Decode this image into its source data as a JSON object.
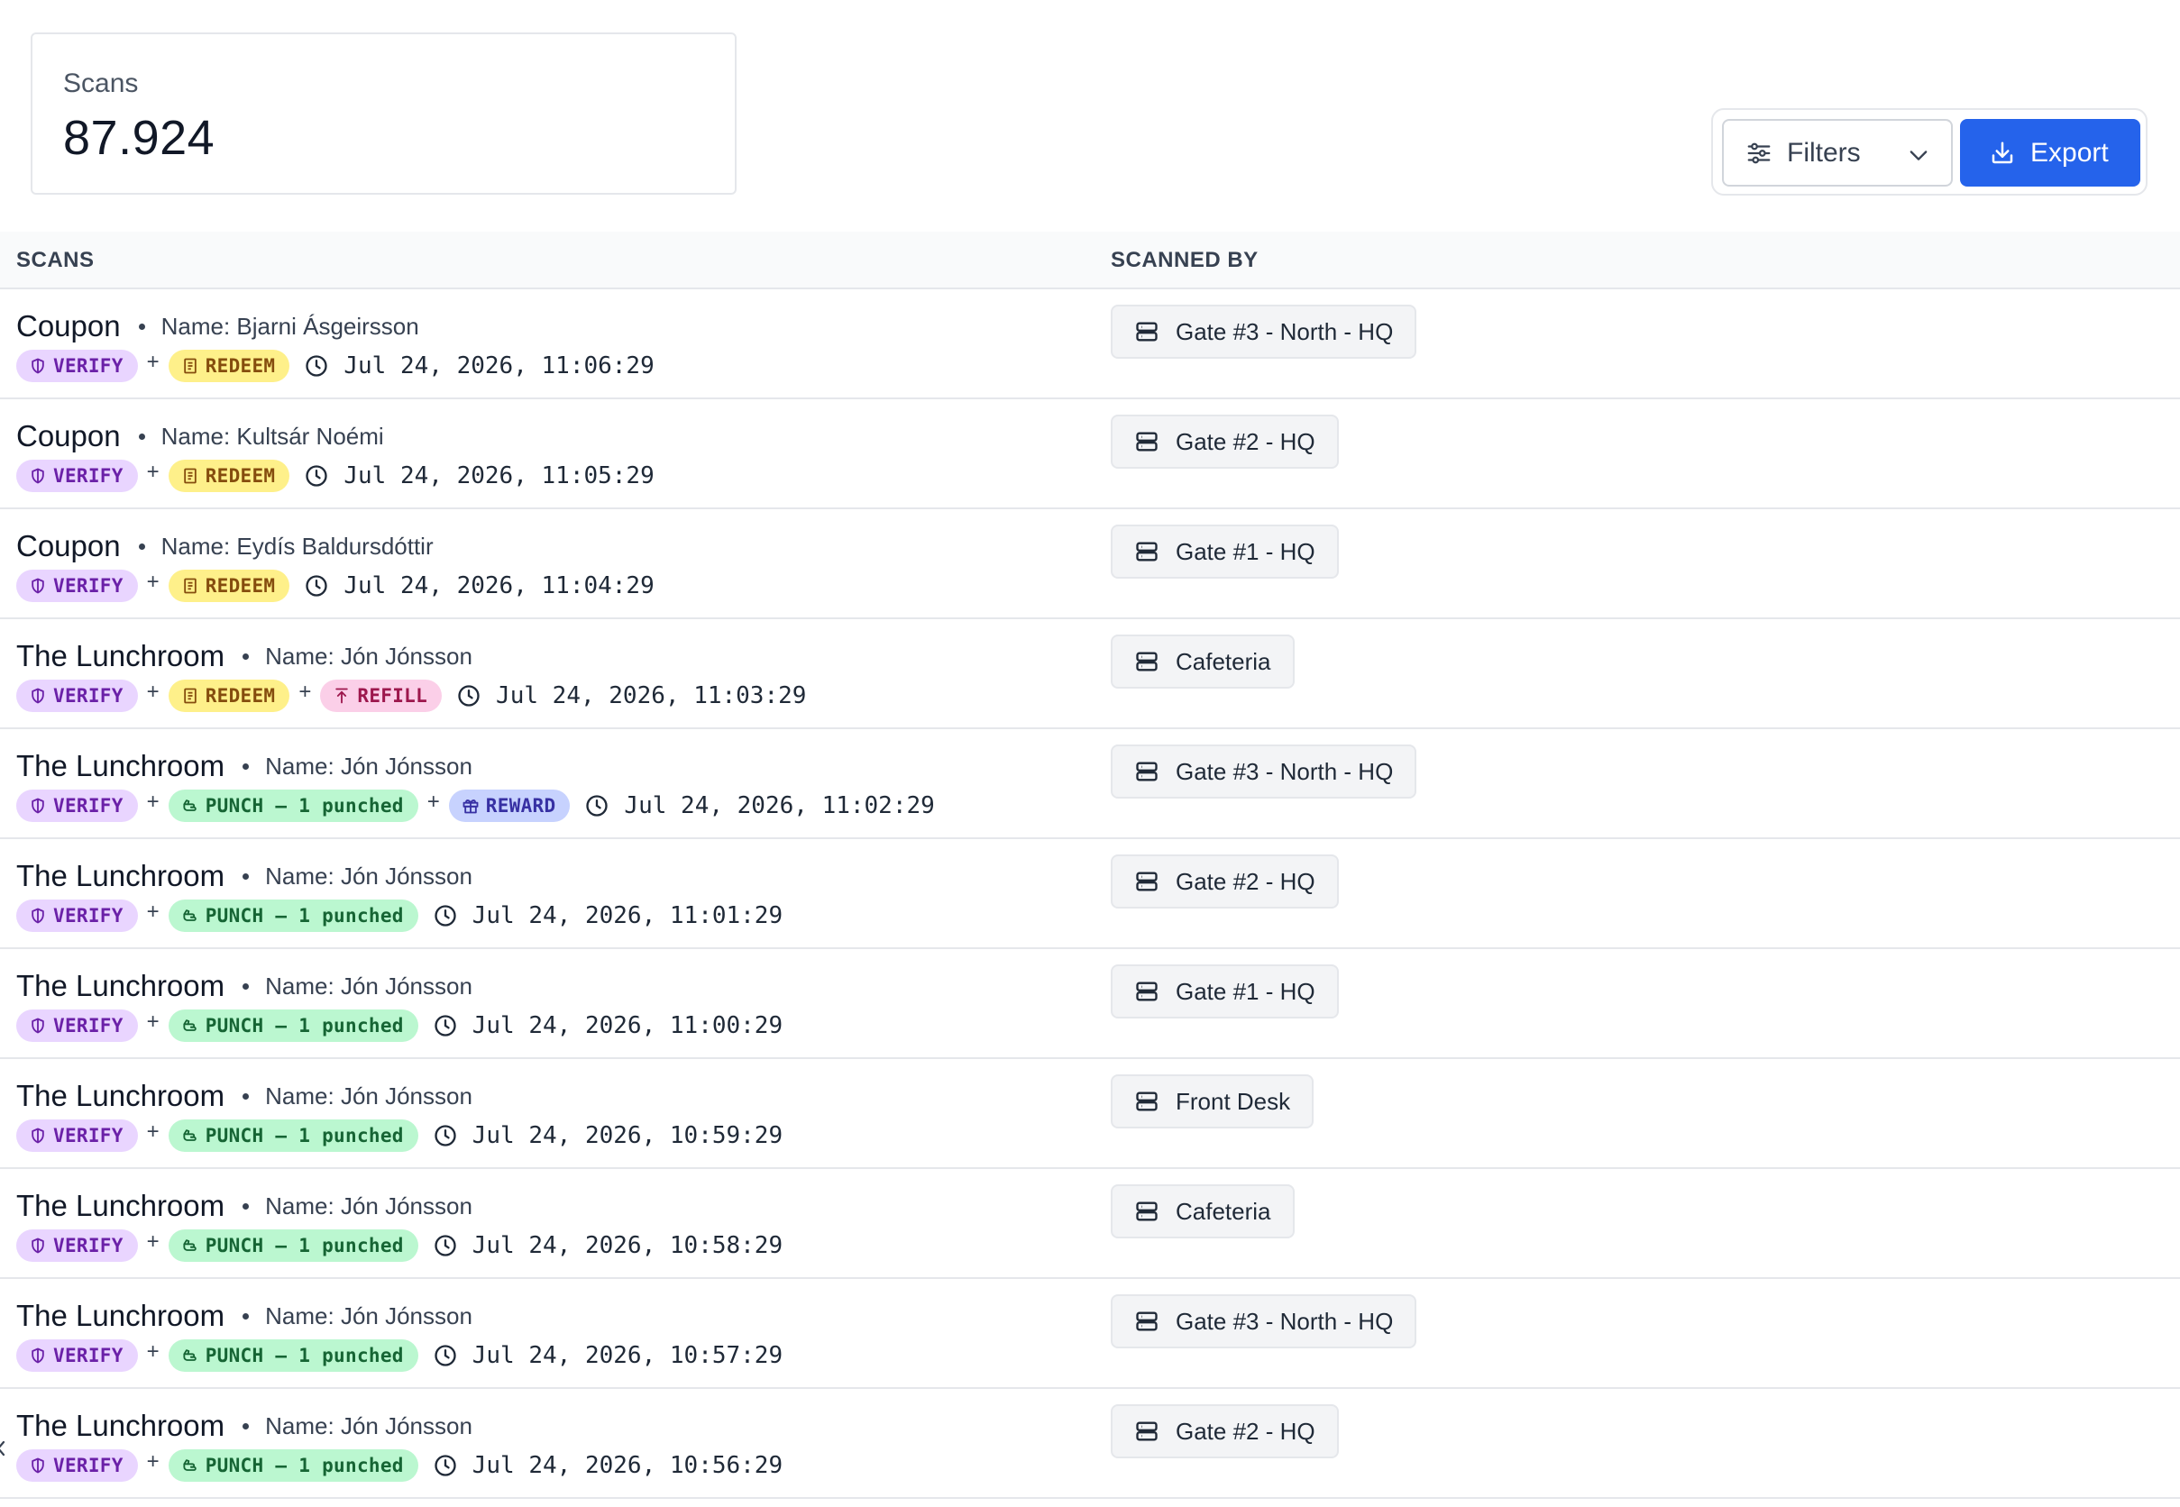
{
  "stat": {
    "label": "Scans",
    "value": "87.924"
  },
  "toolbar": {
    "filters_label": "Filters",
    "export_label": "Export"
  },
  "table": {
    "headers": {
      "scans": "SCANS",
      "scanned_by": "SCANNED BY"
    },
    "rows": [
      {
        "program": "Coupon",
        "person": "Name: Bjarni Ásgeirsson",
        "badges": [
          {
            "type": "verify",
            "label": "VERIFY"
          },
          {
            "type": "redeem",
            "label": "REDEEM"
          }
        ],
        "time": "Jul 24, 2026, 11:06:29",
        "scanner": "Gate #3 - North - HQ"
      },
      {
        "program": "Coupon",
        "person": "Name: Kultsár Noémi",
        "badges": [
          {
            "type": "verify",
            "label": "VERIFY"
          },
          {
            "type": "redeem",
            "label": "REDEEM"
          }
        ],
        "time": "Jul 24, 2026, 11:05:29",
        "scanner": "Gate #2 - HQ"
      },
      {
        "program": "Coupon",
        "person": "Name: Eydís Baldursdóttir",
        "badges": [
          {
            "type": "verify",
            "label": "VERIFY"
          },
          {
            "type": "redeem",
            "label": "REDEEM"
          }
        ],
        "time": "Jul 24, 2026, 11:04:29",
        "scanner": "Gate #1 - HQ"
      },
      {
        "program": "The Lunchroom",
        "person": "Name: Jón Jónsson",
        "badges": [
          {
            "type": "verify",
            "label": "VERIFY"
          },
          {
            "type": "redeem",
            "label": "REDEEM"
          },
          {
            "type": "refill",
            "label": "REFILL"
          }
        ],
        "time": "Jul 24, 2026, 11:03:29",
        "scanner": "Cafeteria"
      },
      {
        "program": "The Lunchroom",
        "person": "Name: Jón Jónsson",
        "badges": [
          {
            "type": "verify",
            "label": "VERIFY"
          },
          {
            "type": "punch",
            "label": "PUNCH – 1 punched"
          },
          {
            "type": "reward",
            "label": "REWARD"
          }
        ],
        "time": "Jul 24, 2026, 11:02:29",
        "scanner": "Gate #3 - North - HQ"
      },
      {
        "program": "The Lunchroom",
        "person": "Name: Jón Jónsson",
        "badges": [
          {
            "type": "verify",
            "label": "VERIFY"
          },
          {
            "type": "punch",
            "label": "PUNCH – 1 punched"
          }
        ],
        "time": "Jul 24, 2026, 11:01:29",
        "scanner": "Gate #2 - HQ"
      },
      {
        "program": "The Lunchroom",
        "person": "Name: Jón Jónsson",
        "badges": [
          {
            "type": "verify",
            "label": "VERIFY"
          },
          {
            "type": "punch",
            "label": "PUNCH – 1 punched"
          }
        ],
        "time": "Jul 24, 2026, 11:00:29",
        "scanner": "Gate #1 - HQ"
      },
      {
        "program": "The Lunchroom",
        "person": "Name: Jón Jónsson",
        "badges": [
          {
            "type": "verify",
            "label": "VERIFY"
          },
          {
            "type": "punch",
            "label": "PUNCH – 1 punched"
          }
        ],
        "time": "Jul 24, 2026, 10:59:29",
        "scanner": "Front Desk"
      },
      {
        "program": "The Lunchroom",
        "person": "Name: Jón Jónsson",
        "badges": [
          {
            "type": "verify",
            "label": "VERIFY"
          },
          {
            "type": "punch",
            "label": "PUNCH – 1 punched"
          }
        ],
        "time": "Jul 24, 2026, 10:58:29",
        "scanner": "Cafeteria"
      },
      {
        "program": "The Lunchroom",
        "person": "Name: Jón Jónsson",
        "badges": [
          {
            "type": "verify",
            "label": "VERIFY"
          },
          {
            "type": "punch",
            "label": "PUNCH – 1 punched"
          }
        ],
        "time": "Jul 24, 2026, 10:57:29",
        "scanner": "Gate #3 - North - HQ"
      },
      {
        "program": "The Lunchroom",
        "person": "Name: Jón Jónsson",
        "badges": [
          {
            "type": "verify",
            "label": "VERIFY"
          },
          {
            "type": "punch",
            "label": "PUNCH – 1 punched"
          }
        ],
        "time": "Jul 24, 2026, 10:56:29",
        "scanner": "Gate #2 - HQ"
      }
    ]
  },
  "colors": {
    "accent": "#2563eb",
    "verify_bg": "#e9d5ff",
    "redeem_bg": "#fef08a",
    "refill_bg": "#fbcfe8",
    "punch_bg": "#bbf7d0",
    "reward_bg": "#c7d2fe"
  },
  "icons": {
    "verify": "shield-icon",
    "redeem": "receipt-icon",
    "refill": "arrow-up-icon",
    "punch": "hand-icon",
    "reward": "gift-icon",
    "time": "clock-icon",
    "scanner": "server-icon",
    "filters": "sliders-icon",
    "export": "download-icon"
  }
}
